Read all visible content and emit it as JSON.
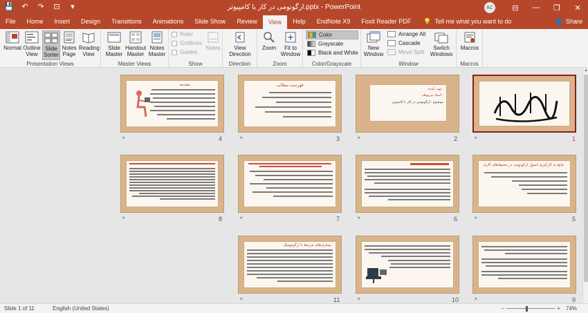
{
  "window": {
    "title": "ارگونومی در کار با کامپیوتر.pptx  -  PowerPoint",
    "avatar": "AC"
  },
  "qat": {
    "save": "💾",
    "undo": "↶",
    "redo": "↷",
    "present": "⊡",
    "customize": "▾"
  },
  "controls": {
    "ribbon_options": "⊟",
    "minimize": "—",
    "restore": "❐",
    "close": "✕"
  },
  "tabs": [
    "File",
    "Home",
    "Insert",
    "Design",
    "Transitions",
    "Animations",
    "Slide Show",
    "Review",
    "View",
    "Help",
    "EndNote X9",
    "Foxit Reader PDF"
  ],
  "active_tab": "View",
  "tell_me": {
    "icon": "💡",
    "text": "Tell me what you want to do"
  },
  "share": {
    "icon": "👤",
    "text": "Share"
  },
  "ribbon": {
    "presentation_views": {
      "label": "Presentation Views",
      "normal": "Normal",
      "outline": "Outline View",
      "slide_sorter": "Slide Sorter",
      "notes_page": "Notes Page",
      "reading_view": "Reading View"
    },
    "master_views": {
      "label": "Master Views",
      "slide_master": "Slide Master",
      "handout_master": "Handout Master",
      "notes_master": "Notes Master"
    },
    "show": {
      "label": "Show",
      "ruler": "Ruler",
      "gridlines": "Gridlines",
      "guides": "Guides",
      "notes": "Notes"
    },
    "direction": {
      "label": "Direction",
      "view_direction": "View Direction"
    },
    "zoom": {
      "label": "Zoom",
      "zoom": "Zoom",
      "fit": "Fit to Window"
    },
    "color": {
      "label": "Color/Grayscale",
      "color": "Color",
      "grayscale": "Grayscale",
      "bw": "Black and White"
    },
    "window": {
      "label": "Window",
      "new_window": "New Window",
      "arrange_all": "Arrange All",
      "cascade": "Cascade",
      "move_split": "Move Split",
      "switch": "Switch Windows"
    },
    "macros": {
      "label": "Macros",
      "macros": "Macros"
    }
  },
  "slides": [
    {
      "num": "1",
      "star": "*",
      "kind": "calligraphy"
    },
    {
      "num": "2",
      "star": "*",
      "kind": "title",
      "line1": "تهیه کننده :",
      "line2": "استاد مربوطه :",
      "line3": "موضوع : ارگونومی در کار با کامپیوتر"
    },
    {
      "num": "3",
      "star": "*",
      "kind": "toc",
      "title": "فهرست مطالب"
    },
    {
      "num": "4",
      "star": "*",
      "kind": "intro",
      "title": "مقدمه"
    },
    {
      "num": "5",
      "star": "*",
      "kind": "bullets",
      "title": "نتایج به کارگیری اصول ارگونومی در محیط‌های کاری"
    },
    {
      "num": "6",
      "star": "*",
      "kind": "text"
    },
    {
      "num": "7",
      "star": "*",
      "kind": "text"
    },
    {
      "num": "8",
      "star": "*",
      "kind": "text"
    },
    {
      "num": "9",
      "star": "*",
      "kind": "text"
    },
    {
      "num": "10",
      "star": "*",
      "kind": "textimg"
    },
    {
      "num": "11",
      "star": "*",
      "kind": "text",
      "title": "بیماری‌های مرتبط با ارگونومیک"
    }
  ],
  "status": {
    "slide": "Slide 1 of 11",
    "language": "English (United States)",
    "zoom": "74%",
    "minus": "−",
    "plus": "+"
  },
  "colors": {
    "accent": "#b7472a",
    "frame": "#d9b48a",
    "selected_border": "#8b1d1d"
  }
}
